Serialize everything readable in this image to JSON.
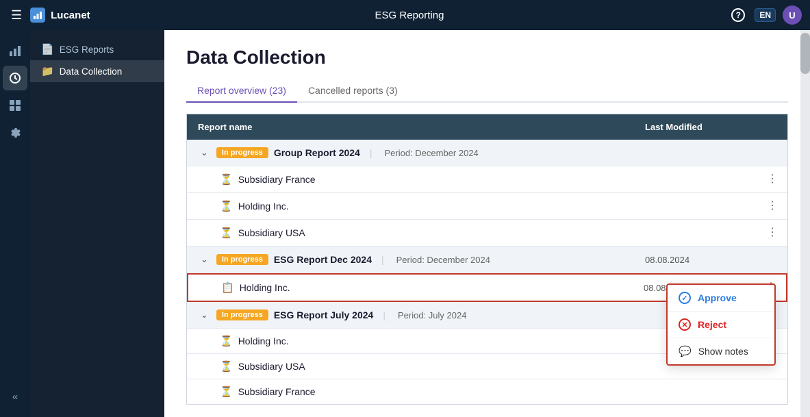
{
  "app": {
    "name": "Lucanet",
    "title": "ESG Reporting"
  },
  "nav": {
    "help_label": "?",
    "lang_label": "EN",
    "hamburger": "☰"
  },
  "sidebar": {
    "items": [
      {
        "id": "esg-reports",
        "label": "ESG Reports",
        "icon": "📄"
      },
      {
        "id": "data-collection",
        "label": "Data Collection",
        "icon": "📁",
        "active": true
      }
    ]
  },
  "page": {
    "title": "Data Collection"
  },
  "tabs": [
    {
      "id": "report-overview",
      "label": "Report overview (23)",
      "active": true
    },
    {
      "id": "cancelled-reports",
      "label": "Cancelled reports (3)",
      "active": false
    }
  ],
  "table": {
    "headers": {
      "name": "Report name",
      "modified": "Last Modified",
      "actions": ""
    },
    "rows": [
      {
        "id": "group-2024",
        "type": "group",
        "status": "In progress",
        "name": "Group Report 2024",
        "period": "December 2024",
        "modified": "",
        "expanded": true
      },
      {
        "id": "sub-france",
        "type": "sub",
        "icon": "clock",
        "name": "Subsidiary France",
        "modified": "",
        "has_more": true
      },
      {
        "id": "sub-holding",
        "type": "sub",
        "icon": "clock",
        "name": "Holding Inc.",
        "modified": "",
        "has_more": true
      },
      {
        "id": "sub-usa",
        "type": "sub",
        "icon": "clock",
        "name": "Subsidiary USA",
        "modified": "",
        "has_more": true
      },
      {
        "id": "esg-dec-2024",
        "type": "group",
        "status": "In progress",
        "name": "ESG Report Dec 2024",
        "period": "December 2024",
        "modified": "08.08.2024",
        "expanded": true
      },
      {
        "id": "holding-dec",
        "type": "sub",
        "icon": "doc",
        "name": "Holding Inc.",
        "modified": "08.08.2024",
        "has_more": true,
        "selected": true
      },
      {
        "id": "esg-july-2024",
        "type": "group",
        "status": "In progress",
        "name": "ESG Report July 2024",
        "period": "July 2024",
        "modified": "",
        "expanded": true
      },
      {
        "id": "sub-holding-july",
        "type": "sub",
        "icon": "clock",
        "name": "Holding Inc.",
        "modified": "",
        "has_more": false
      },
      {
        "id": "sub-usa-july",
        "type": "sub",
        "icon": "clock",
        "name": "Subsidiary USA",
        "modified": "",
        "has_more": false
      },
      {
        "id": "sub-france-july",
        "type": "sub",
        "icon": "clock",
        "name": "Subsidiary France",
        "modified": "",
        "has_more": false
      }
    ]
  },
  "context_menu": {
    "items": [
      {
        "id": "approve",
        "label": "Approve",
        "icon": "✓",
        "style": "approve"
      },
      {
        "id": "reject",
        "label": "Reject",
        "icon": "✕",
        "style": "reject"
      },
      {
        "id": "show-notes",
        "label": "Show notes",
        "icon": "💬",
        "style": "notes"
      }
    ]
  }
}
